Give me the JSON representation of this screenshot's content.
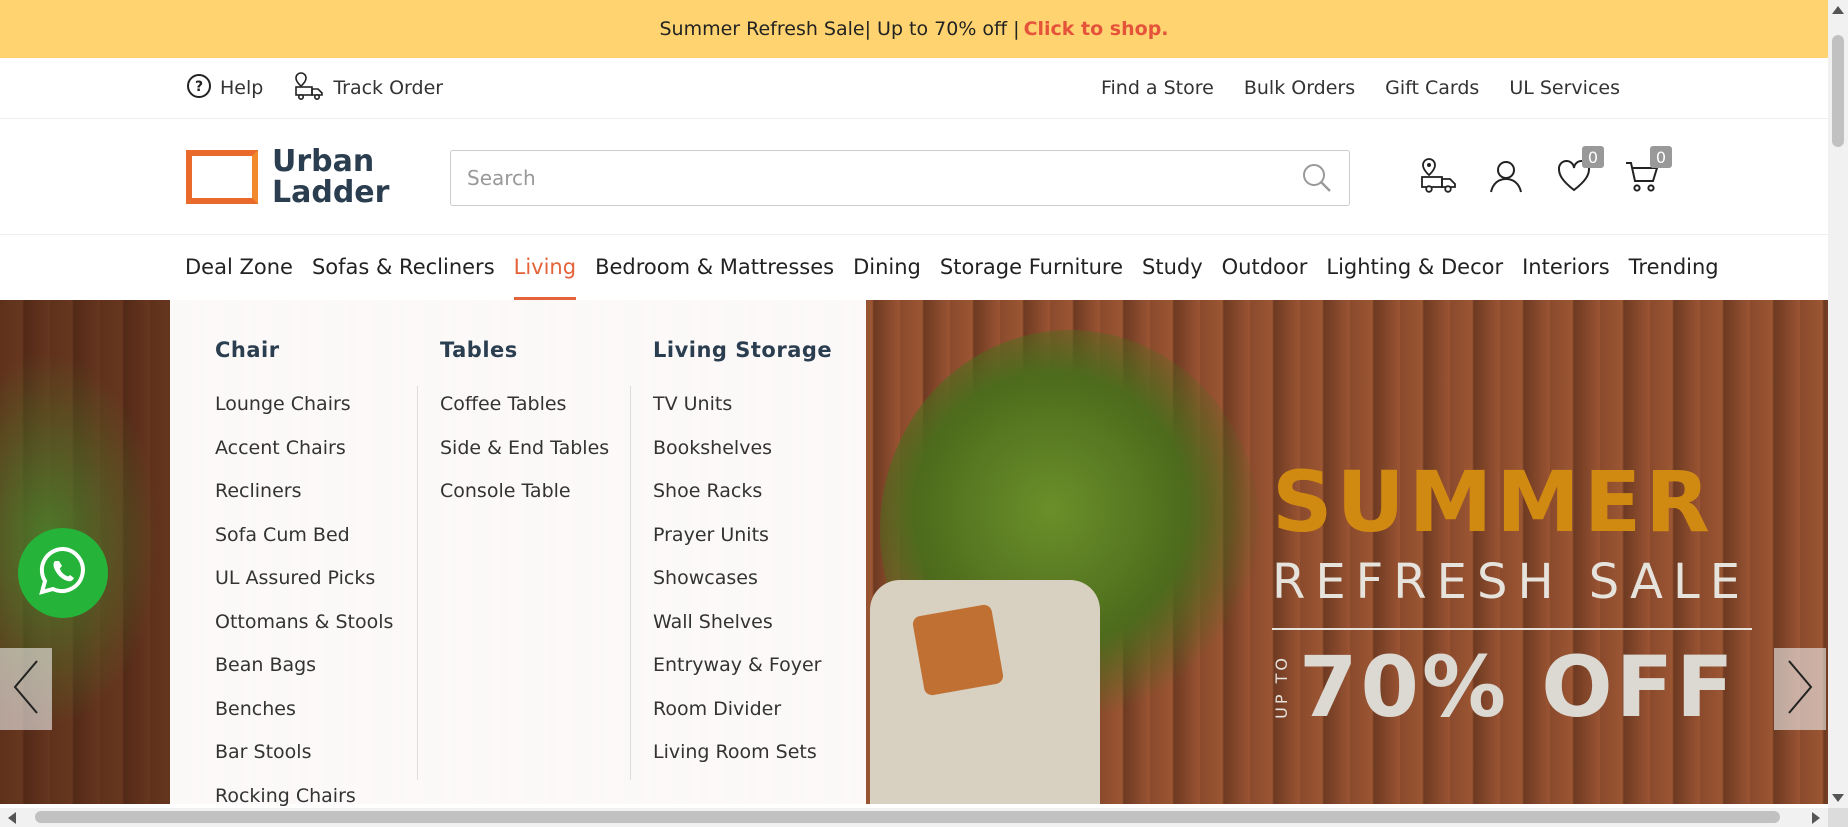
{
  "announcement": {
    "text": "Summer Refresh Sale| Up to 70% off |",
    "cta": "Click to shop."
  },
  "utility": {
    "help": "Help",
    "track_order": "Track Order",
    "links": [
      "Find a Store",
      "Bulk Orders",
      "Gift Cards",
      "UL Services"
    ]
  },
  "logo": {
    "line1": "Urban",
    "line2": "Ladder"
  },
  "search": {
    "placeholder": "Search"
  },
  "header_icons": {
    "wishlist_count": "0",
    "cart_count": "0"
  },
  "nav": {
    "items": [
      "Deal Zone",
      "Sofas & Recliners",
      "Living",
      "Bedroom & Mattresses",
      "Dining",
      "Storage Furniture",
      "Study",
      "Outdoor",
      "Lighting & Decor",
      "Interiors",
      "Trending"
    ],
    "active": "Living"
  },
  "mega_menu": {
    "columns": [
      {
        "heading": "Chair",
        "items": [
          "Lounge Chairs",
          "Accent Chairs",
          "Recliners",
          "Sofa Cum Bed",
          "UL Assured Picks",
          "Ottomans & Stools",
          "Bean Bags",
          "Benches",
          "Bar Stools",
          "Rocking Chairs"
        ]
      },
      {
        "heading": "Tables",
        "items": [
          "Coffee Tables",
          "Side & End Tables",
          "Console Table"
        ]
      },
      {
        "heading": "Living Storage",
        "items": [
          "TV Units",
          "Bookshelves",
          "Shoe Racks",
          "Prayer Units",
          "Showcases",
          "Wall Shelves",
          "Entryway & Foyer",
          "Room Divider",
          "Living Room Sets"
        ]
      }
    ]
  },
  "banner": {
    "line1": "SUMMER",
    "line2": "REFRESH SALE",
    "upto": "UP TO",
    "discount": "70% OFF"
  },
  "colors": {
    "accent": "#e5633b",
    "announcement_bg": "#ffd470",
    "brand_dark": "#2b3e50",
    "whatsapp": "#25b33a"
  }
}
